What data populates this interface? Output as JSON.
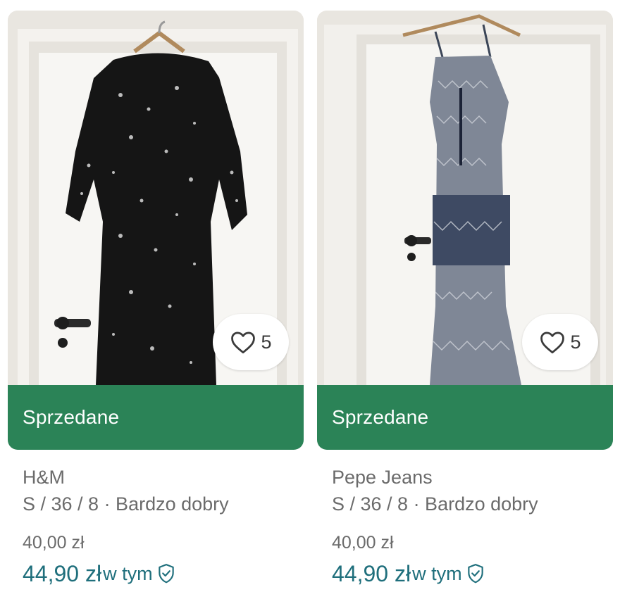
{
  "items": [
    {
      "favorite_count": "5",
      "status_label": "Sprzedane",
      "brand": "H&M",
      "details": "S / 36 / 8 · Bardzo dobry",
      "price": "40,00 zł",
      "price_with_protection": "44,90 zł",
      "protection_label": "w tym",
      "photo_desc": "black floral dress on hanger"
    },
    {
      "favorite_count": "5",
      "status_label": "Sprzedane",
      "brand": "Pepe Jeans",
      "details": "S / 36 / 8 · Bardzo dobry",
      "price": "40,00 zł",
      "price_with_protection": "44,90 zł",
      "protection_label": "w tym",
      "photo_desc": "blue patterned maxi dress on hanger"
    }
  ],
  "colors": {
    "sold_banner": "#2b8357",
    "price_accent": "#1f6f7c",
    "muted_text": "#6b6b6b"
  },
  "icons": {
    "favorite": "heart-outline-icon",
    "protection": "shield-check-icon"
  }
}
